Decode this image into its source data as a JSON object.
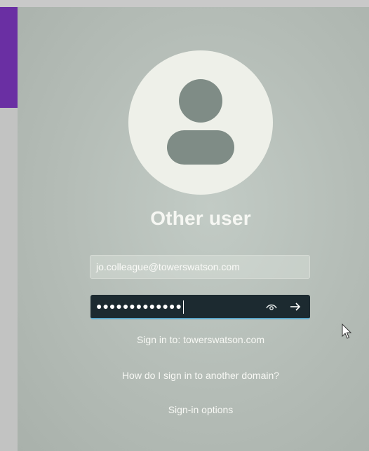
{
  "user": {
    "title": "Other user"
  },
  "form": {
    "username_value": "jo.colleague@towerswatson.com",
    "password_masked": "●●●●●●●●●●●●●",
    "reveal_icon": "eye-icon",
    "submit_icon": "arrow-right-icon"
  },
  "links": {
    "sign_in_to": "Sign in to: towerswatson.com",
    "domain_help": "How do I sign in to another domain?",
    "sign_in_options": "Sign-in options"
  },
  "colors": {
    "accent_purple": "#6a2fa3",
    "password_bg": "#1c2a30",
    "focus_underline": "#5aa6c8",
    "avatar_bg": "#eef0e9",
    "avatar_glyph": "#7f8c86"
  }
}
